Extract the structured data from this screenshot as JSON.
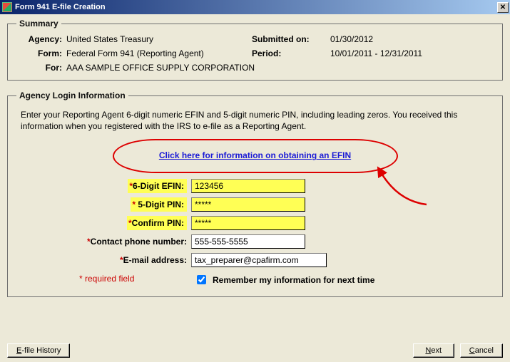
{
  "window": {
    "title": "Form 941 E-file Creation"
  },
  "summary": {
    "legend": "Summary",
    "agency_label": "Agency:",
    "agency_value": "United States Treasury",
    "form_label": "Form:",
    "form_value": "Federal Form 941 (Reporting Agent)",
    "for_label": "For:",
    "for_value": "AAA SAMPLE OFFICE SUPPLY CORPORATION",
    "submitted_label": "Submitted on:",
    "submitted_value": "01/30/2012",
    "period_label": "Period:",
    "period_value": "10/01/2011 - 12/31/2011"
  },
  "login": {
    "legend": "Agency Login Information",
    "instructions": "Enter your Reporting Agent 6-digit numeric EFIN and 5-digit numeric PIN, including leading zeros. You received this information when you registered with the IRS to e-file as a Reporting Agent.",
    "efin_link": "Click here for information on obtaining an EFIN",
    "efin_label": "6-Digit EFIN:",
    "efin_value": "123456",
    "pin_label": "5-Digit PIN:",
    "pin_value": "*****",
    "confirm_label": "Confirm PIN:",
    "confirm_value": "*****",
    "phone_label": "Contact phone number:",
    "phone_value": "555-555-5555",
    "email_label": "E-mail address:",
    "email_value": "tax_preparer@cpafirm.com",
    "remember_label": "Remember my information for next time",
    "required_note": "* required field"
  },
  "footer": {
    "history": "E-file History",
    "next": "Next",
    "cancel": "Cancel"
  }
}
